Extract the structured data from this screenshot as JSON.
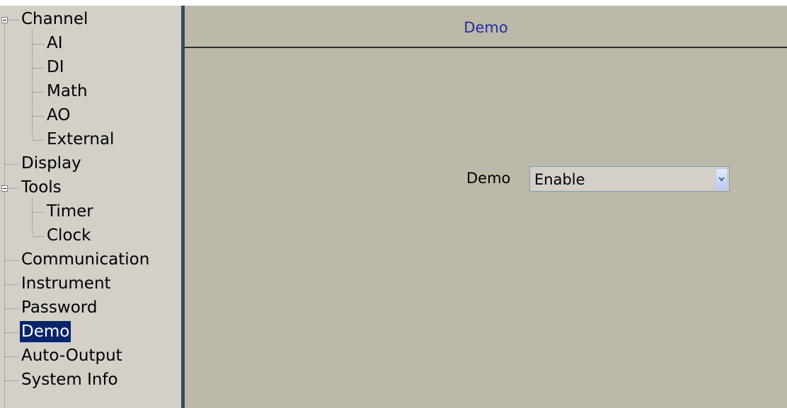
{
  "sidebar": {
    "items": [
      {
        "label": "Channel",
        "expandable": true
      },
      {
        "label": "AI"
      },
      {
        "label": "DI"
      },
      {
        "label": "Math"
      },
      {
        "label": "AO"
      },
      {
        "label": "External"
      },
      {
        "label": "Display"
      },
      {
        "label": "Tools",
        "expandable": true
      },
      {
        "label": "Timer"
      },
      {
        "label": "Clock"
      },
      {
        "label": "Communication"
      },
      {
        "label": "Instrument"
      },
      {
        "label": "Password"
      },
      {
        "label": "Demo",
        "selected": true
      },
      {
        "label": "Auto-Output"
      },
      {
        "label": "System Info"
      }
    ]
  },
  "main": {
    "title": "Demo",
    "field": {
      "label": "Demo",
      "value": "Enable"
    }
  },
  "colors": {
    "sidebar_bg": "#d4d0c8",
    "panel_bg": "#bdb9a8",
    "title_text": "#1f2f9e",
    "selection_bg": "#0a246a",
    "divider": "#3c4a5a"
  },
  "icons": {
    "expander": "tree-collapse-icon",
    "dropdown": "chevron-down-icon"
  }
}
